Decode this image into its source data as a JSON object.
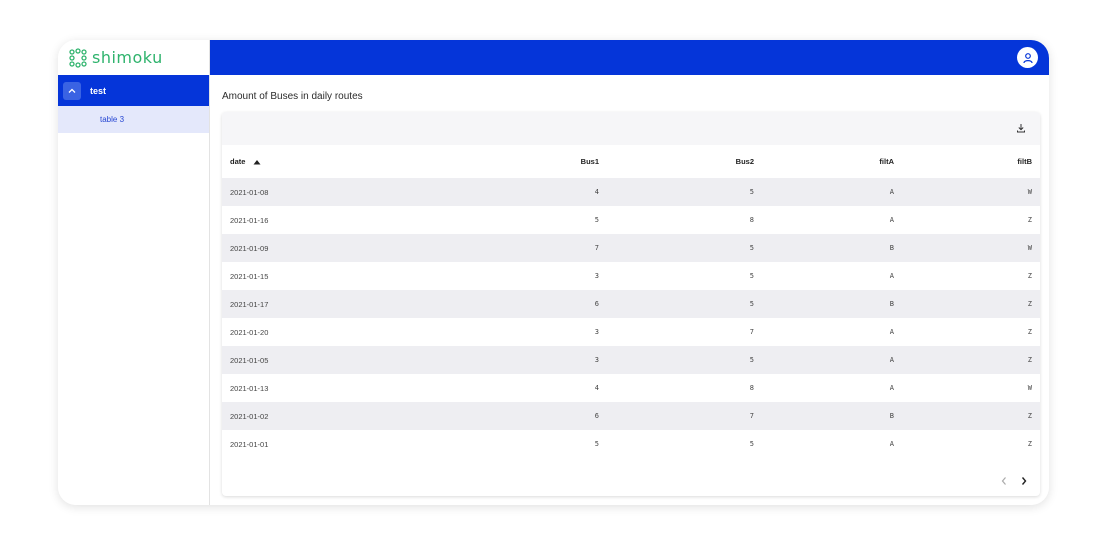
{
  "brand": {
    "name": "shimoku",
    "color": "#2fb36d"
  },
  "colors": {
    "primary": "#0535d9",
    "subnav_bg": "#e4e8fb"
  },
  "sidebar": {
    "group": {
      "label": "test",
      "toggle_icon": "chevron-up-icon"
    },
    "items": [
      {
        "label": "table 3"
      }
    ]
  },
  "topbar": {
    "avatar_icon": "user-icon"
  },
  "main": {
    "title": "Amount of Buses in daily routes",
    "download_icon": "download-icon",
    "columns": [
      "date",
      "Bus1",
      "Bus2",
      "filtA",
      "filtB"
    ],
    "sort": {
      "column": "date",
      "direction": "asc"
    },
    "rows": [
      [
        "2021-01-08",
        "4",
        "5",
        "A",
        "W"
      ],
      [
        "2021-01-16",
        "5",
        "8",
        "A",
        "Z"
      ],
      [
        "2021-01-09",
        "7",
        "5",
        "B",
        "W"
      ],
      [
        "2021-01-15",
        "3",
        "5",
        "A",
        "Z"
      ],
      [
        "2021-01-17",
        "6",
        "5",
        "B",
        "Z"
      ],
      [
        "2021-01-20",
        "3",
        "7",
        "A",
        "Z"
      ],
      [
        "2021-01-05",
        "3",
        "5",
        "A",
        "Z"
      ],
      [
        "2021-01-13",
        "4",
        "8",
        "A",
        "W"
      ],
      [
        "2021-01-02",
        "6",
        "7",
        "B",
        "Z"
      ],
      [
        "2021-01-01",
        "5",
        "5",
        "A",
        "Z"
      ]
    ],
    "pager": {
      "prev_icon": "chevron-left-icon",
      "next_icon": "chevron-right-icon"
    }
  }
}
